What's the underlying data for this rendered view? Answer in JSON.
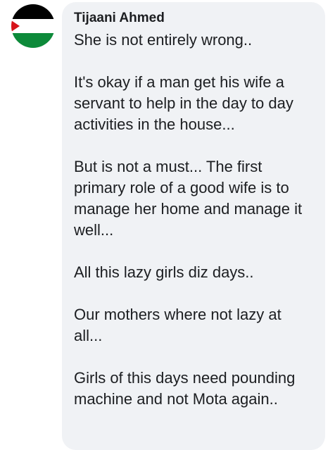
{
  "comment": {
    "author_name": "Tijaani Ahmed",
    "avatar_icon": "flag-avatar-icon",
    "flag_colors": {
      "top": "#000000",
      "middle": "#ffffff",
      "bottom": "#0d8a3a",
      "triangle": "#d7141a"
    },
    "paragraphs": [
      "She is not entirely wrong..",
      "It's okay if a man get his wife a servant to help in the day to day activities in the house...",
      "But is not a must... The first primary role of a good wife is to manage her home and manage it well...",
      "All this lazy girls diz days..",
      "Our mothers where not lazy at all...",
      "Girls of this days need pounding machine and not Mota again.."
    ]
  }
}
